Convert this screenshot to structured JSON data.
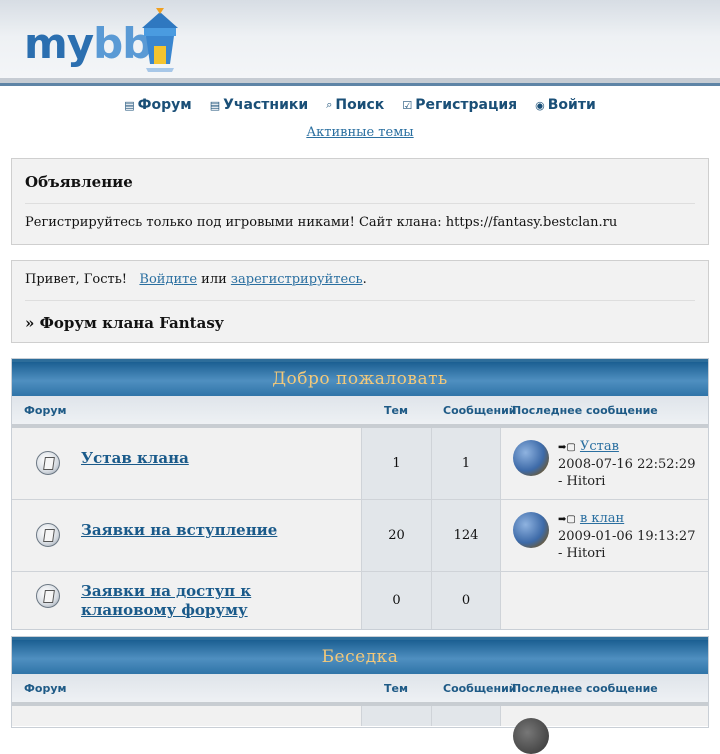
{
  "logo": {
    "text_my": "my",
    "text_bb": "bb"
  },
  "nav": [
    {
      "icon": "▤",
      "label": "Форум"
    },
    {
      "icon": "▤",
      "label": "Участники"
    },
    {
      "icon": "⌕",
      "label": "Поиск"
    },
    {
      "icon": "☑",
      "label": "Регистрация"
    },
    {
      "icon": "◉",
      "label": "Войти"
    }
  ],
  "active_topics": "Активные темы",
  "announcement": {
    "title": "Объявление",
    "text": "Регистрируйтесь только под игровыми никами! Сайт клана: https://fantasy.bestclan.ru"
  },
  "welcome": {
    "greeting": "Привет, Гость!",
    "login": "Войдите",
    "or": "или",
    "register": "зарегистрируйтесь",
    "dot": ".",
    "crumb": "» Форум клана Fantasy"
  },
  "columns": {
    "forum": "Форум",
    "topics": "Тем",
    "posts": "Сообщений",
    "last": "Последнее сообщение"
  },
  "categories": [
    {
      "title": "Добро пожаловать",
      "forums": [
        {
          "name": "Устав клана",
          "topics": "1",
          "posts": "1",
          "last_title": "Устав",
          "last_date": "2008-07-16 22:52:29",
          "last_author": "- Hitori"
        },
        {
          "name": "Заявки на вступление",
          "topics": "20",
          "posts": "124",
          "last_title": "в клан",
          "last_date": "2009-01-06 19:13:27",
          "last_author": "- Hitori"
        },
        {
          "name_line1": "Заявки на доступ к",
          "name_line2": "клановому форуму",
          "topics": "0",
          "posts": "0"
        }
      ]
    },
    {
      "title": "Беседка"
    }
  ]
}
